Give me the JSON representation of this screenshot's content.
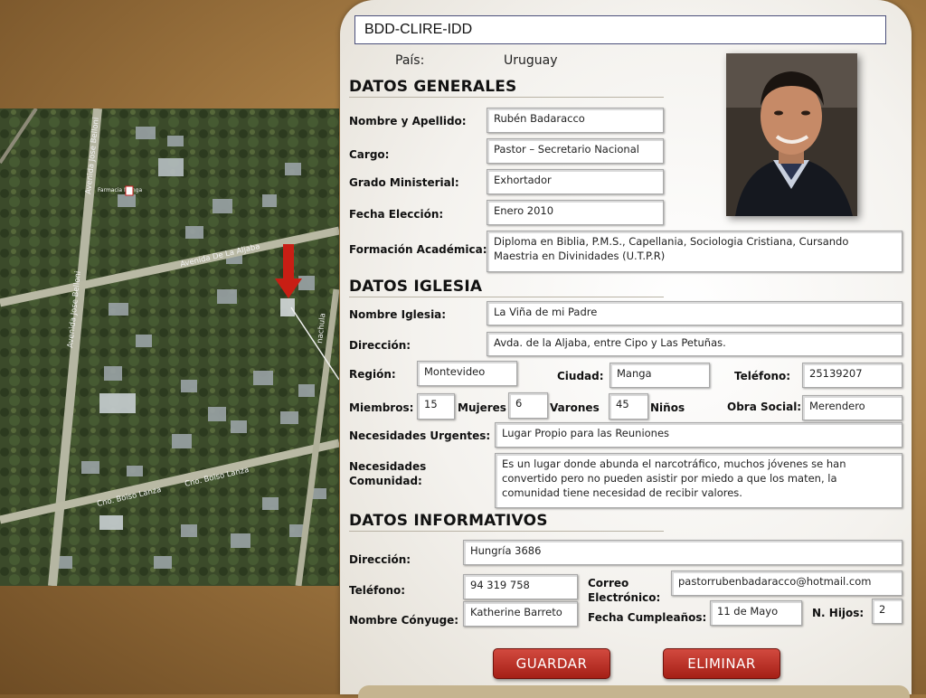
{
  "title": "BDD-CLIRE-IDD",
  "country": {
    "label": "País:",
    "value": "Uruguay"
  },
  "map": {
    "streets": [
      "Avenida Jose Belloni",
      "Avenida Jose Belloni",
      "Avenida De La Aljaba",
      "Cno. Boiso Lanza",
      "Cno. Boiso Lanza",
      "nachula"
    ],
    "pharmacy": "Farmacia Manga"
  },
  "general": {
    "heading": "DATOS GENERALES",
    "name_label": "Nombre y Apellido:",
    "name": "Rubén Badaracco",
    "cargo_label": "Cargo:",
    "cargo": "Pastor – Secretario Nacional",
    "grado_label": "Grado Ministerial:",
    "grado": "Exhortador",
    "fecha_label": "Fecha Elección:",
    "fecha": "Enero 2010",
    "formacion_label": "Formación Académica:",
    "formacion": "Diploma en Biblia, P.M.S., Capellania, Sociologia Cristiana, Cursando Maestria en Divinidades (U.T.P.R)"
  },
  "iglesia": {
    "heading": "DATOS IGLESIA",
    "nombre_label": "Nombre Iglesia:",
    "nombre": "La Viña de mi Padre",
    "direccion_label": "Dirección:",
    "direccion": "Avda. de la Aljaba, entre Cipo y Las Petuñas.",
    "region_label": "Región:",
    "region": "Montevideo",
    "ciudad_label": "Ciudad:",
    "ciudad": "Manga",
    "telefono_label": "Teléfono:",
    "telefono": "25139207",
    "miembros_label": "Miembros:",
    "miembros": "15",
    "mujeres_label": "Mujeres",
    "mujeres": "6",
    "varones_label": "Varones",
    "varones": "45",
    "ninos_label": "Niños",
    "obra_label": "Obra Social:",
    "obra": "Merendero",
    "necesidades_label": "Necesidades Urgentes:",
    "necesidades": "Lugar Propio para las Reuniones",
    "comunidad_label": "Necesidades Comunidad:",
    "comunidad": "Es un lugar donde abunda el narcotráfico, muchos jóvenes se han convertido pero no pueden asistir por miedo a que los maten, la comunidad tiene necesidad de recibir valores."
  },
  "informativos": {
    "heading": "DATOS INFORMATIVOS",
    "direccion_label": "Dirección:",
    "direccion": "Hungría 3686",
    "telefono_label": "Teléfono:",
    "telefono": "94 319 758",
    "correo_label": "Correo Electrónico:",
    "correo": "pastorrubenbadaracco@hotmail.com",
    "conyuge_label": "Nombre Cónyuge:",
    "conyuge": "Katherine Barreto",
    "cumple_label": "Fecha Cumpleaños:",
    "cumple": "11 de Mayo",
    "hijos_label": "N. Hijos:",
    "hijos": "2"
  },
  "buttons": {
    "guardar": "GUARDAR",
    "eliminar": "ELIMINAR"
  },
  "colors": {
    "button": "#b8281e",
    "title_border": "#4a4f7a"
  },
  "icons": {
    "arrow": "red-arrow-down-icon",
    "pharmacy": "pharmacy-marker-icon"
  }
}
